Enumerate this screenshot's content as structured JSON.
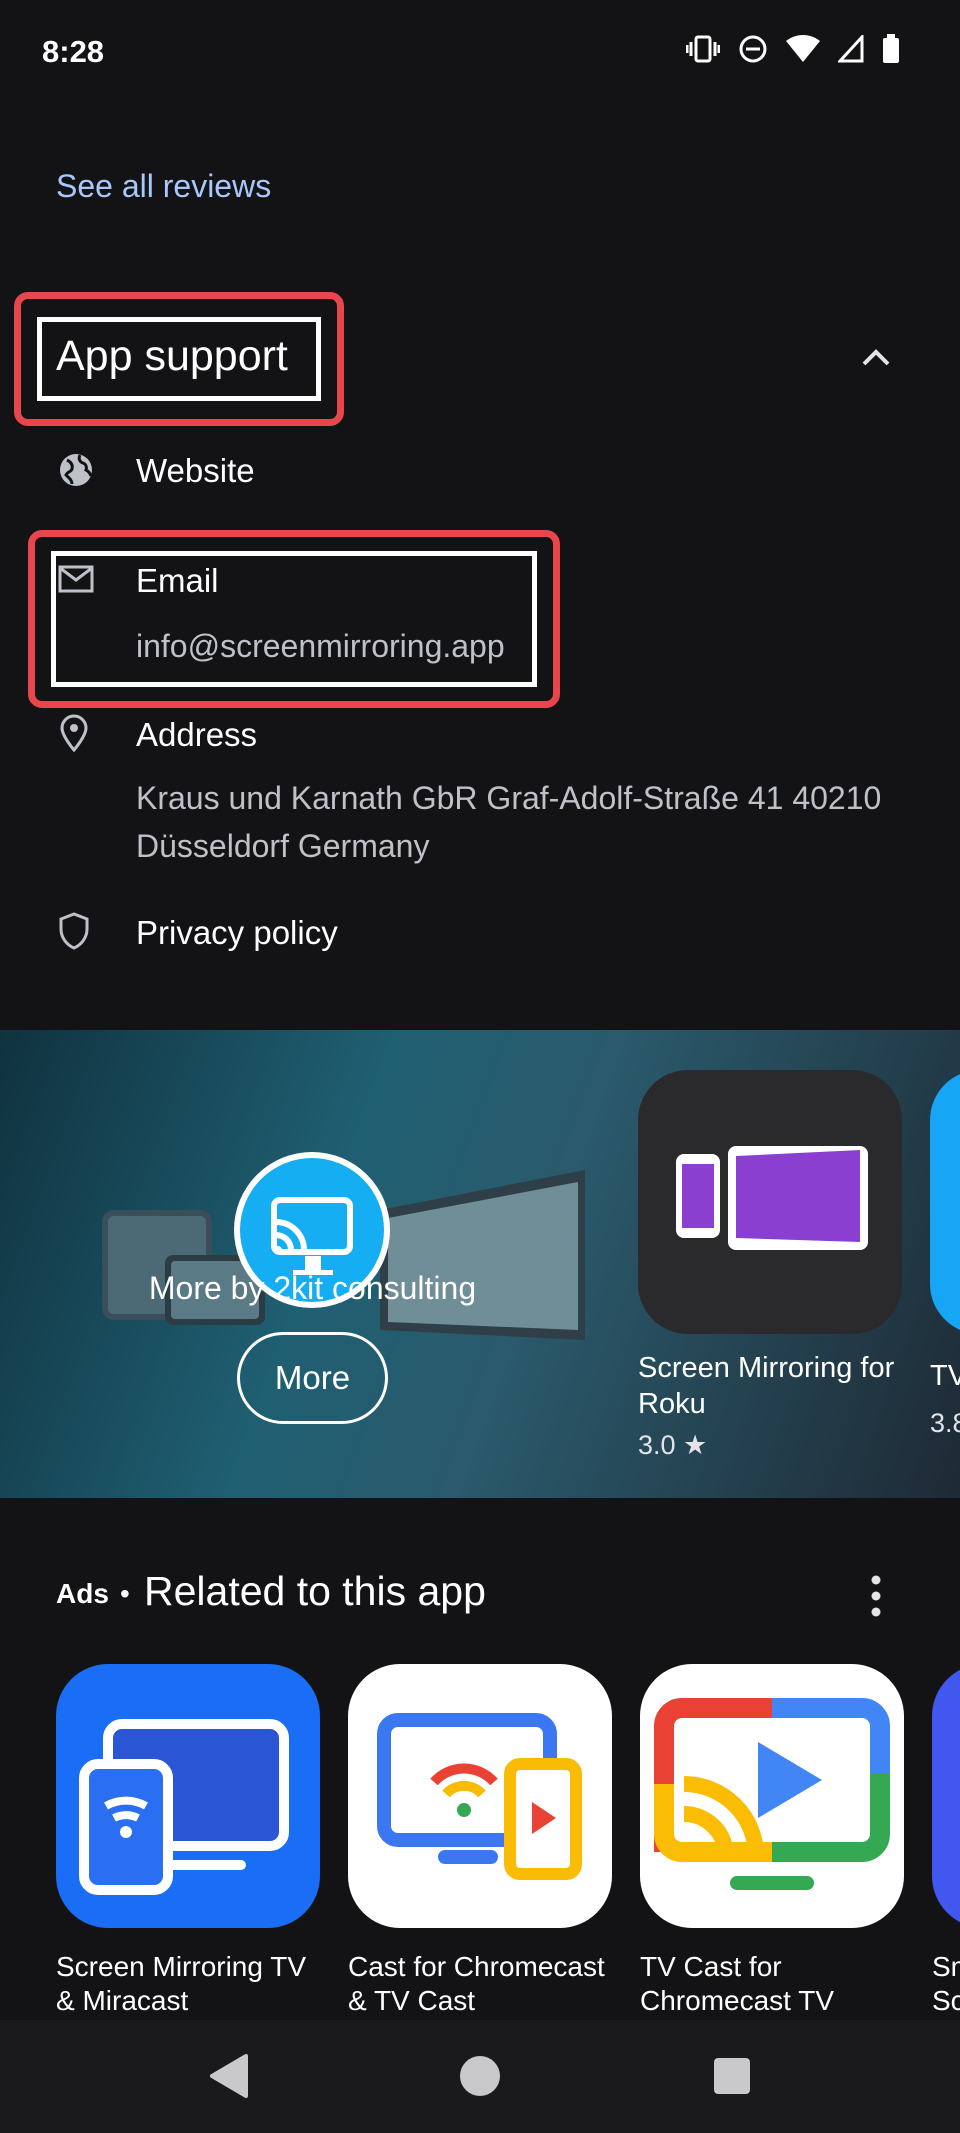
{
  "status_bar": {
    "time": "8:28",
    "icons": [
      "vibrate-icon",
      "dnd-icon",
      "wifi-icon",
      "signal-icon",
      "battery-icon"
    ]
  },
  "reviews": {
    "see_all_label": "See all reviews"
  },
  "app_support": {
    "title": "App support",
    "items": [
      {
        "icon": "globe-icon",
        "label": "Website",
        "value": ""
      },
      {
        "icon": "mail-icon",
        "label": "Email",
        "value": "info@screenmirroring.app"
      },
      {
        "icon": "location-pin-icon",
        "label": "Address",
        "value_line1": "Kraus und Karnath GbR Graf-Adolf-Straße 41 40210",
        "value_line2": "Düsseldorf Germany"
      },
      {
        "icon": "shield-icon",
        "label": "Privacy policy",
        "value": ""
      }
    ]
  },
  "developer_banner": {
    "more_by_text": "More by 2kit consulting",
    "more_button_label": "More",
    "featured_app": {
      "name_line1": "Screen Mirroring for",
      "name_line2": "Roku",
      "rating": "3.0 ★"
    },
    "peek_app": {
      "name_fragment": "TV",
      "rating_fragment": "3.8"
    }
  },
  "related": {
    "ads_label": "Ads",
    "separator": "•",
    "title": "Related to this app",
    "apps": [
      {
        "name_line1": "Screen Mirroring TV",
        "name_line2": "& Miracast"
      },
      {
        "name_line1": "Cast for Chromecast",
        "name_line2": "& TV Cast"
      },
      {
        "name_line1": "TV Cast for",
        "name_line2": "Chromecast TV"
      },
      {
        "name_line1": "Sm",
        "name_line2": "Sc"
      }
    ]
  },
  "colors": {
    "background": "#131316",
    "link": "#a8c7fa",
    "highlight": "#e8454d"
  }
}
